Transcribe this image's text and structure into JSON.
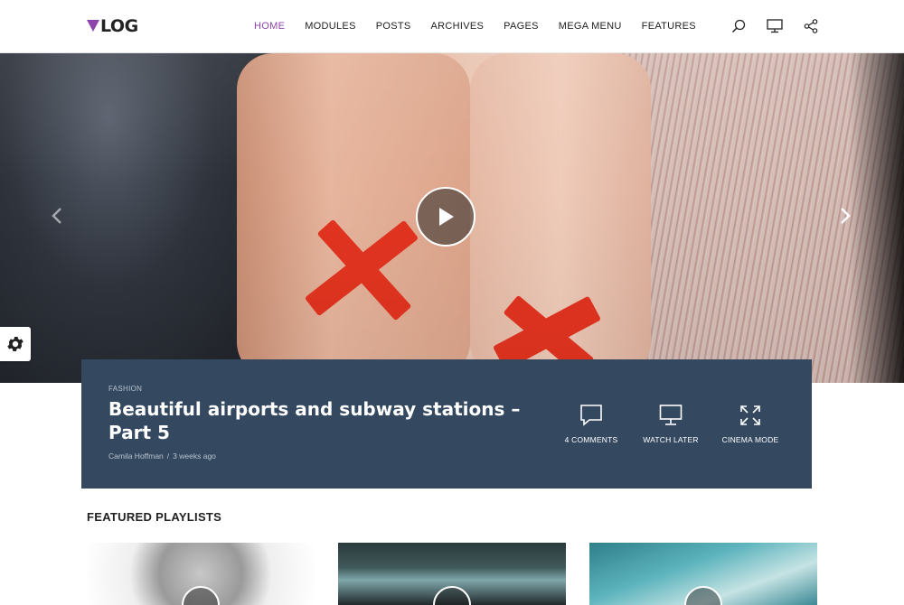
{
  "logo": {
    "text": "LOG",
    "accent": "#8e44ad"
  },
  "nav": {
    "items": [
      "HOME",
      "MODULES",
      "POSTS",
      "ARCHIVES",
      "PAGES",
      "MEGA MENU",
      "FEATURES"
    ],
    "active": "HOME"
  },
  "header_icons": [
    "search-icon",
    "monitor-icon",
    "share-icon"
  ],
  "hero": {
    "arrows": [
      "chevron-left-icon",
      "chevron-right-icon"
    ],
    "play_icon": "play-icon"
  },
  "post": {
    "category": "FASHION",
    "title": "Beautiful airports and subway stations – Part 5",
    "author": "Camila Hoffman",
    "time": "3 weeks ago",
    "actions": [
      {
        "label": "4 COMMENTS",
        "icon": "comment-icon"
      },
      {
        "label": "WATCH LATER",
        "icon": "monitor-icon"
      },
      {
        "label": "CINEMA MODE",
        "icon": "expand-icon"
      }
    ],
    "box_color": "#344860"
  },
  "featured": {
    "title": "FEATURED PLAYLISTS"
  }
}
